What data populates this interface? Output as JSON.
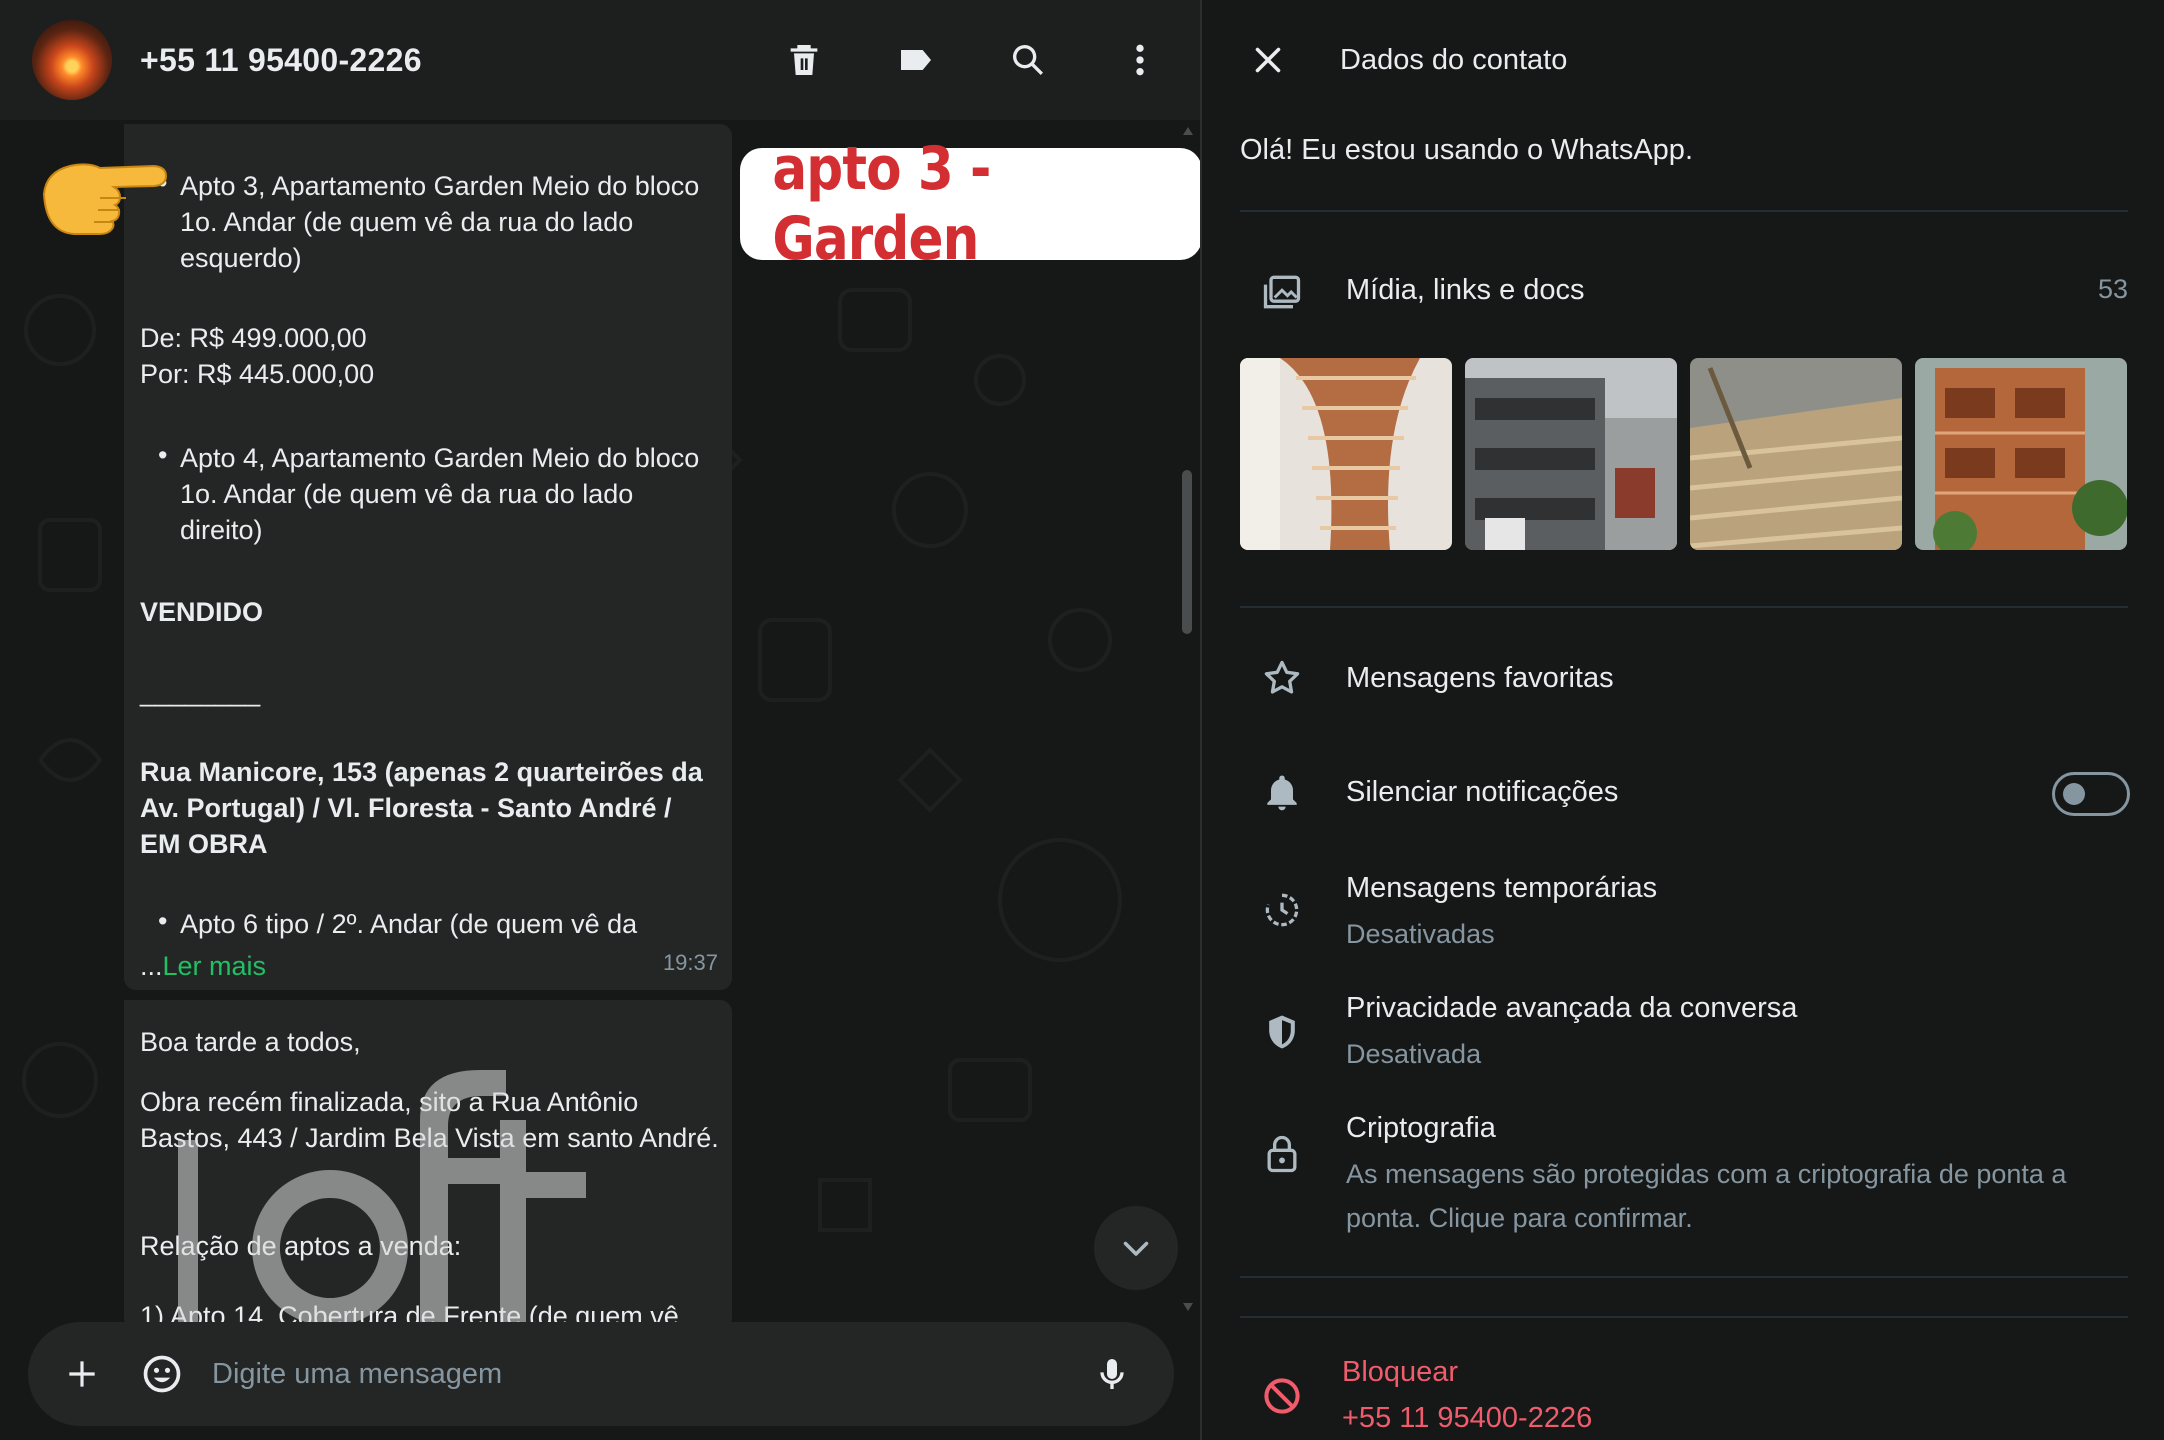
{
  "chat": {
    "contact_number": "+55 11 95400-2226",
    "annotation": "apto 3 - Garden",
    "message1": {
      "lines": [
        "Apto 3, Apartamento Garden Meio do bloco",
        "1o. Andar (de quem vê da rua do lado",
        "esquerdo)",
        "De: R$ 499.000,00",
        "Por: R$ 445.000,00",
        "Apto 4, Apartamento Garden Meio do bloco",
        "1o. Andar (de quem vê da rua do lado",
        "direito)",
        "VENDIDO",
        "________",
        "Rua Manicore, 153 (apenas 2 quarteirões da",
        "Av. Portugal) / Vl. Floresta - Santo André /",
        "EM OBRA",
        "Apto 6 tipo / 2º. Andar (de quem vê da"
      ],
      "ellipsis": "...",
      "read_more": "Ler mais",
      "time": "19:37"
    },
    "message2": {
      "lines": [
        "Boa tarde a todos,",
        "Obra recém finalizada, sito a Rua Antônio",
        "Bastos, 443 / Jardim Bela Vista em santo André.",
        "Relação de aptos a venda:",
        "1)      Apto 14, Cobertura de Frente (de quem vê"
      ]
    },
    "composer_placeholder": "Digite uma mensagem",
    "watermark": "loft"
  },
  "contact_info": {
    "title": "Dados do contato",
    "about": "Olá! Eu estou usando o WhatsApp.",
    "media_label": "Mídia, links e docs",
    "media_count": "53",
    "favorites_label": "Mensagens favoritas",
    "mute_label": "Silenciar notificações",
    "mute_enabled": false,
    "disappearing_label": "Mensagens temporárias",
    "disappearing_value": "Desativadas",
    "privacy_label": "Privacidade avançada da conversa",
    "privacy_value": "Desativada",
    "encryption_label": "Criptografia",
    "encryption_line1": "As mensagens são protegidas com a criptografia de ponta a",
    "encryption_line2": "ponta. Clique para confirmar.",
    "block_label": "Bloquear",
    "block_number": "+55 11 95400-2226"
  },
  "icons": {
    "header": [
      "delete-icon",
      "label-icon",
      "search-icon",
      "menu-icon"
    ],
    "composer": [
      "plus-icon",
      "emoji-icon",
      "mic-icon"
    ],
    "panel": [
      "close-icon",
      "media-icon",
      "star-icon",
      "bell-icon",
      "timer-icon",
      "shield-icon",
      "lock-icon",
      "block-icon"
    ]
  },
  "colors": {
    "app_background": "#161717",
    "bubble": "#242626",
    "read_more": "#21c063",
    "annotation_text": "#d32f33",
    "danger": "#f15c6d",
    "secondary_text": "#8696a0"
  }
}
